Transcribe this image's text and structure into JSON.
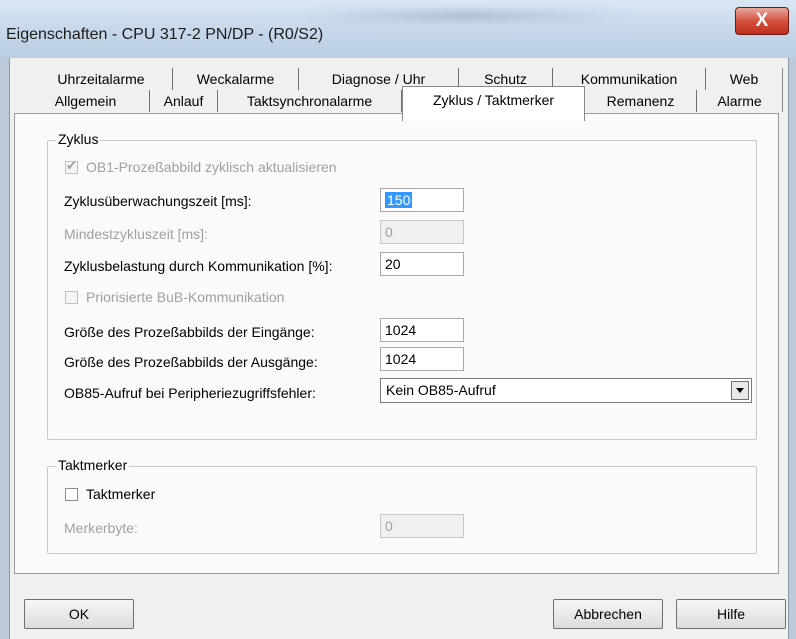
{
  "window": {
    "title": "Eigenschaften - CPU 317-2 PN/DP - (R0/S2)",
    "close_label": "X"
  },
  "tabs": {
    "row1": [
      "Uhrzeitalarme",
      "Weckalarme",
      "Diagnose / Uhr",
      "Schutz",
      "Kommunikation",
      "Web"
    ],
    "row2": [
      "Allgemein",
      "Anlauf",
      "Taktsynchronalarme",
      "Zyklus / Taktmerker",
      "Remanenz",
      "Alarme"
    ],
    "active": "Zyklus / Taktmerker"
  },
  "zyklus": {
    "group_label": "Zyklus",
    "ob1_label": "OB1-Prozeßabbild zyklisch aktualisieren",
    "ob1_checked": true,
    "ueberwachungszeit_label": "Zyklusüberwachungszeit [ms]:",
    "ueberwachungszeit_value": "150",
    "mindestzykluszeit_label": "Mindestzykluszeit [ms]:",
    "mindestzykluszeit_value": "0",
    "belastung_label": "Zyklusbelastung durch Kommunikation [%]:",
    "belastung_value": "20",
    "bub_label": "Priorisierte BuB-Kommunikation",
    "bub_checked": false,
    "eingaenge_label": "Größe des Prozeßabbilds der Eingänge:",
    "eingaenge_value": "1024",
    "ausgaenge_label": "Größe des Prozeßabbilds der Ausgänge:",
    "ausgaenge_value": "1024",
    "ob85_label": "OB85-Aufruf bei Peripheriezugriffsfehler:",
    "ob85_value": "Kein OB85-Aufruf"
  },
  "taktmerker": {
    "group_label": "Taktmerker",
    "checkbox_label": "Taktmerker",
    "checked": false,
    "merkerbyte_label": "Merkerbyte:",
    "merkerbyte_value": "0"
  },
  "buttons": {
    "ok": "OK",
    "abbrechen": "Abbrechen",
    "hilfe": "Hilfe"
  }
}
